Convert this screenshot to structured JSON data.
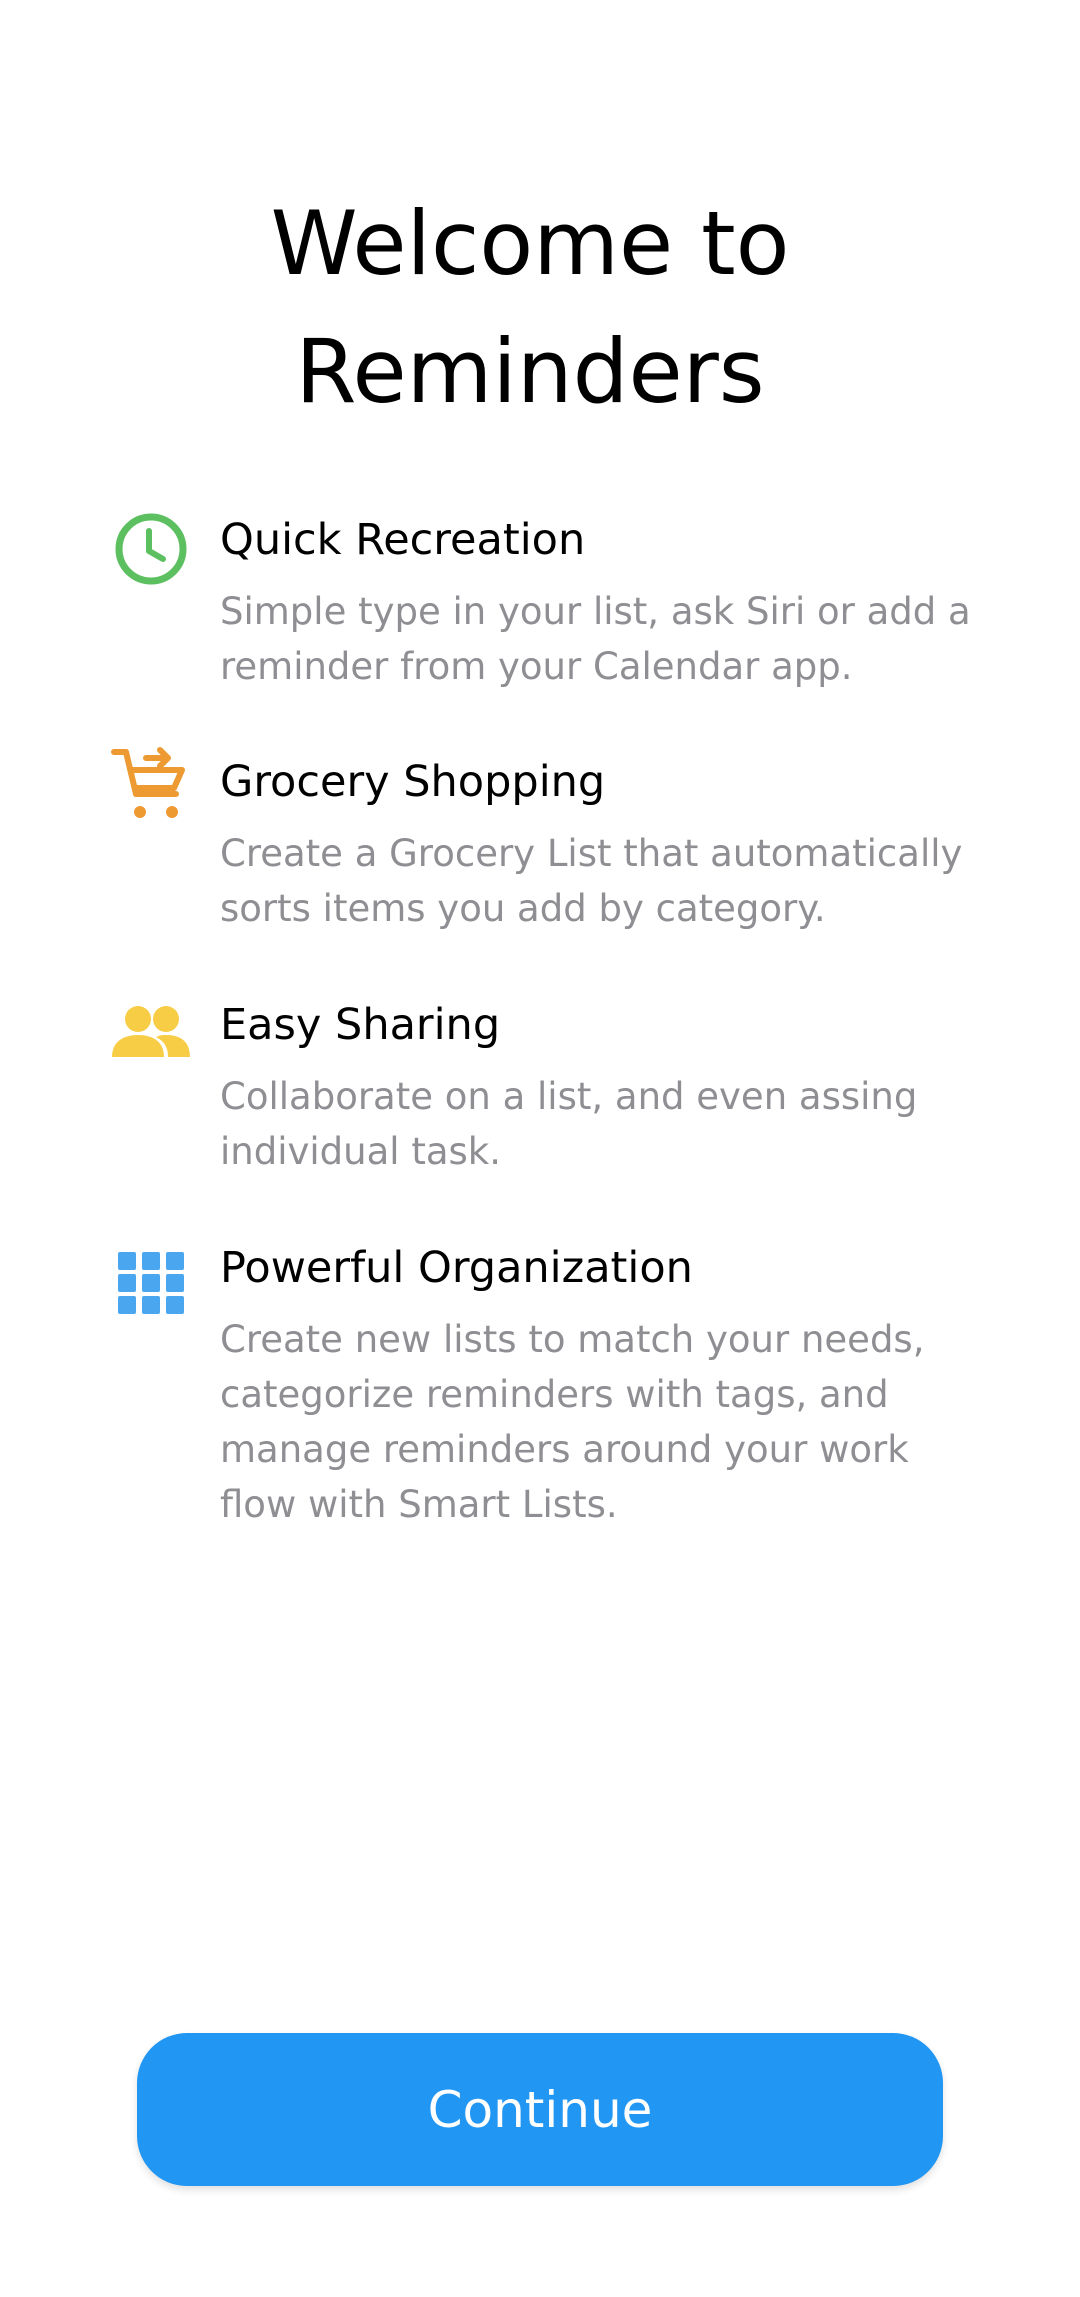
{
  "header": {
    "title_line1": "Welcome to",
    "title_line2": "Reminders"
  },
  "features": [
    {
      "title": "Quick Recreation",
      "description": "Simple type in your list, ask Siri or add a reminder from your Calendar app.",
      "icon": "clock-icon",
      "color": "#5cbf60"
    },
    {
      "title": "Grocery Shopping",
      "description": "Create a Grocery List that automatically sorts items you add by category.",
      "icon": "shopping-cart-icon",
      "color": "#ee9a33"
    },
    {
      "title": "Easy Sharing",
      "description": "Collaborate on a list, and even assing individual task.",
      "icon": "people-icon",
      "color": "#f8cd46"
    },
    {
      "title": "Powerful Organization",
      "description": "Create new lists to match your needs, categorize reminders with tags, and manage reminders around your work flow with Smart Lists.",
      "icon": "grid-icon",
      "color": "#4aa6ee"
    }
  ],
  "actions": {
    "continue_label": "Continue",
    "accent_color": "#2196f3"
  }
}
